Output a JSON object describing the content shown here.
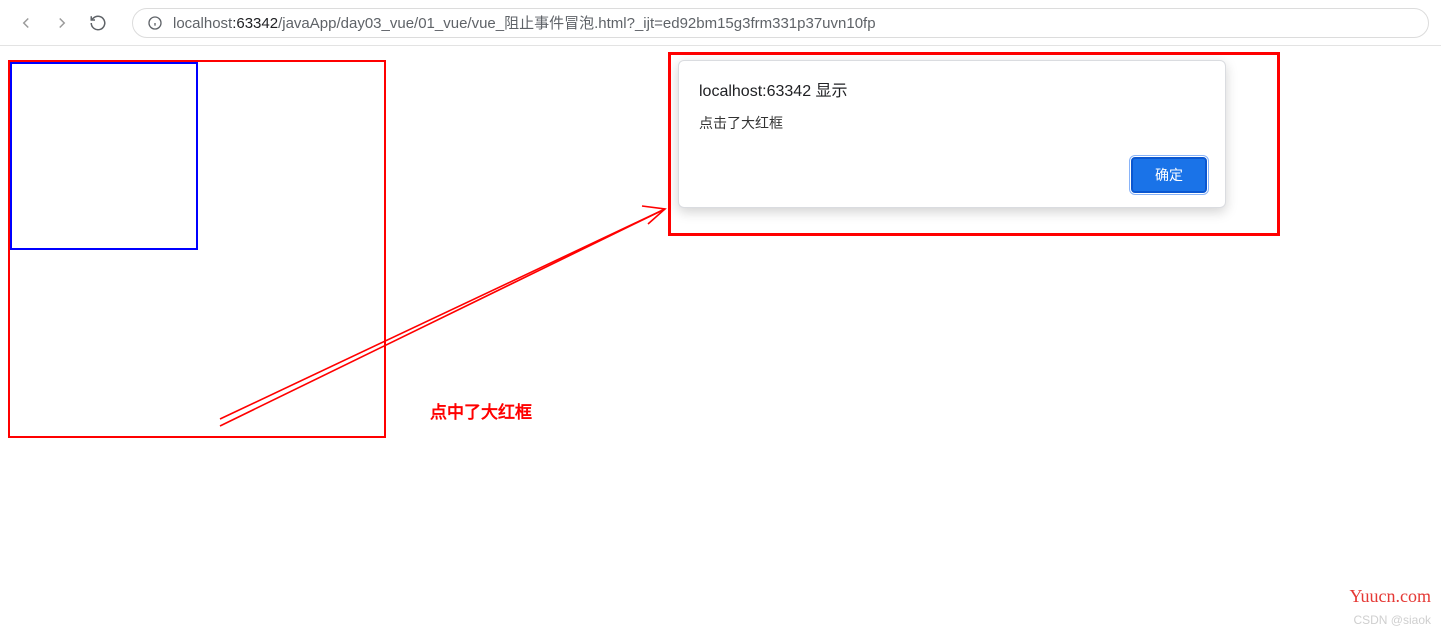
{
  "toolbar": {
    "url_host_gray": "localhost",
    "url_host_black": ":63342",
    "url_path": "/javaApp/day03_vue/01_vue/vue_阻止事件冒泡.html?_ijt=ed92bm15g3frm331p37uvn10fp"
  },
  "dialog": {
    "title": "localhost:63342 显示",
    "message": "点击了大红框",
    "ok_label": "确定"
  },
  "annotation": {
    "text": "点中了大红框"
  },
  "watermark": {
    "site": "Yuucn.com",
    "csdn": "CSDN @siaok"
  },
  "colors": {
    "red": "#ff0000",
    "blue": "#0000ff",
    "primary_button": "#1a73e8"
  }
}
